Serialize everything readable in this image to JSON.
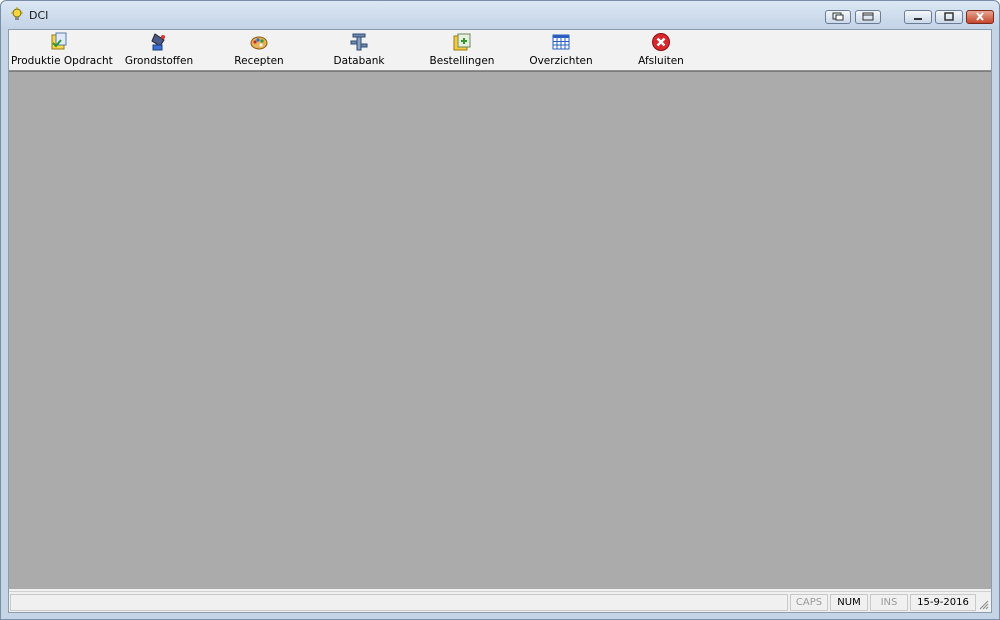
{
  "window": {
    "title": "DCI",
    "controls": [
      "restore-child",
      "close-child",
      "minimize",
      "maximize",
      "close"
    ]
  },
  "toolbar": {
    "items": [
      {
        "label": "Produktie Opdracht",
        "icon": "production-order-icon"
      },
      {
        "label": "Grondstoffen",
        "icon": "raw-materials-icon"
      },
      {
        "label": "Recepten",
        "icon": "palette-icon"
      },
      {
        "label": "Databank",
        "icon": "database-tool-icon"
      },
      {
        "label": "Bestellingen",
        "icon": "orders-icon"
      },
      {
        "label": "Overzichten",
        "icon": "table-grid-icon"
      },
      {
        "label": "Afsluiten",
        "icon": "exit-icon"
      }
    ]
  },
  "statusbar": {
    "caps": "CAPS",
    "num": "NUM",
    "ins": "INS",
    "date": "15-9-2016"
  },
  "colors": {
    "client_area": "#ababab",
    "title_gradient_top": "#dbe7f4",
    "close_button": "#c4462c"
  }
}
